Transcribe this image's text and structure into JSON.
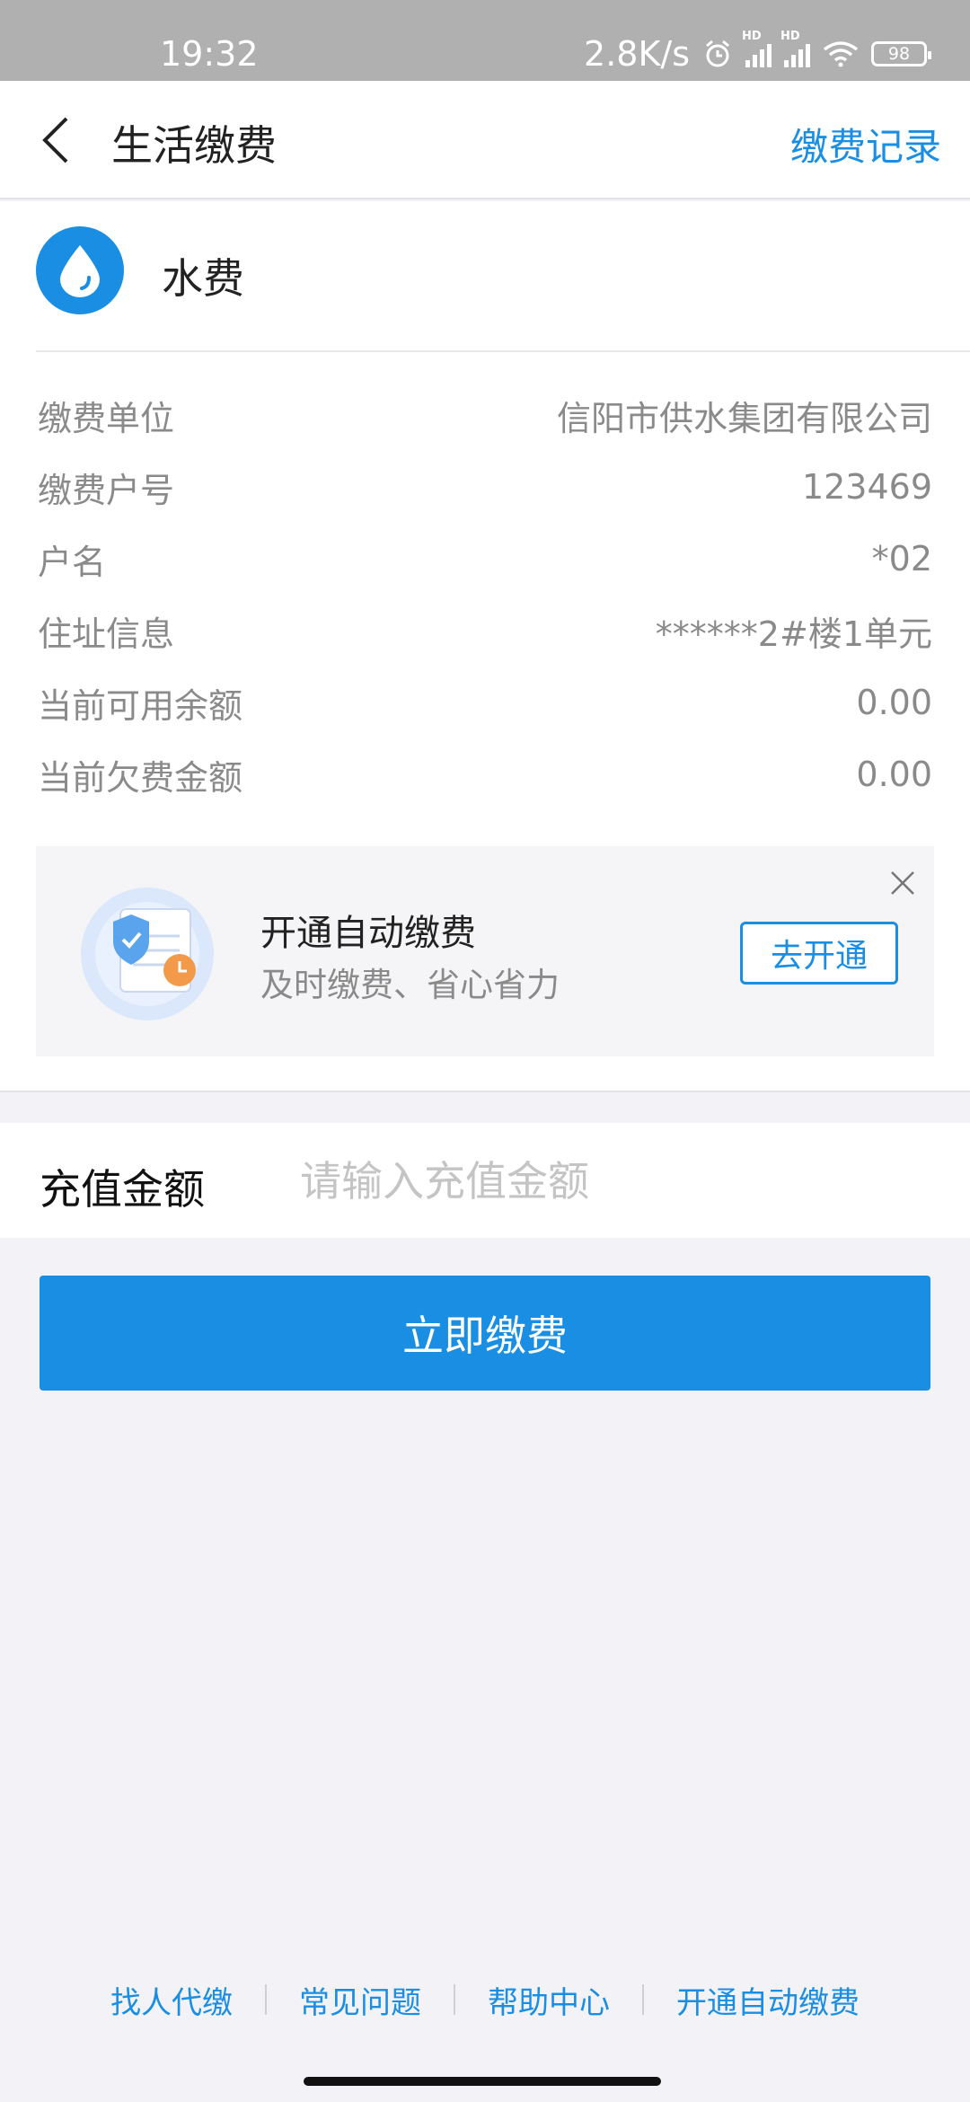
{
  "status_bar": {
    "time": "19:32",
    "net_speed": "2.8K/s",
    "hd_label": "HD",
    "battery": "98",
    "icons": [
      "alarm-icon",
      "signal-icon",
      "signal-icon",
      "wifi-icon",
      "battery-icon"
    ]
  },
  "nav": {
    "title": "生活缴费",
    "right_link": "缴费记录",
    "back_icon": "chevron-left-icon"
  },
  "bill": {
    "icon": "water-drop-icon",
    "name": "水费",
    "rows": [
      {
        "label": "缴费单位",
        "value": "信阳市供水集团有限公司"
      },
      {
        "label": "缴费户号",
        "value": "123469"
      },
      {
        "label": "户名",
        "value": "*02"
      },
      {
        "label": "住址信息",
        "value": "******2#楼1单元"
      },
      {
        "label": "当前可用余额",
        "value": "0.00"
      },
      {
        "label": "当前欠费金额",
        "value": "0.00"
      }
    ]
  },
  "promo": {
    "title": "开通自动缴费",
    "subtitle": "及时缴费、省心省力",
    "button": "去开通",
    "illustration": "shield-bill-clock-icon"
  },
  "recharge": {
    "label": "充值金额",
    "placeholder": "请输入充值金额",
    "value": ""
  },
  "pay_button": "立即缴费",
  "footer_links": [
    "找人代缴",
    "常见问题",
    "帮助中心",
    "开通自动缴费"
  ],
  "colors": {
    "accent": "#1a8ee3",
    "status_bar": "#b0b0b0",
    "background": "#f2f2f7",
    "muted_text": "#8a8a8a"
  }
}
